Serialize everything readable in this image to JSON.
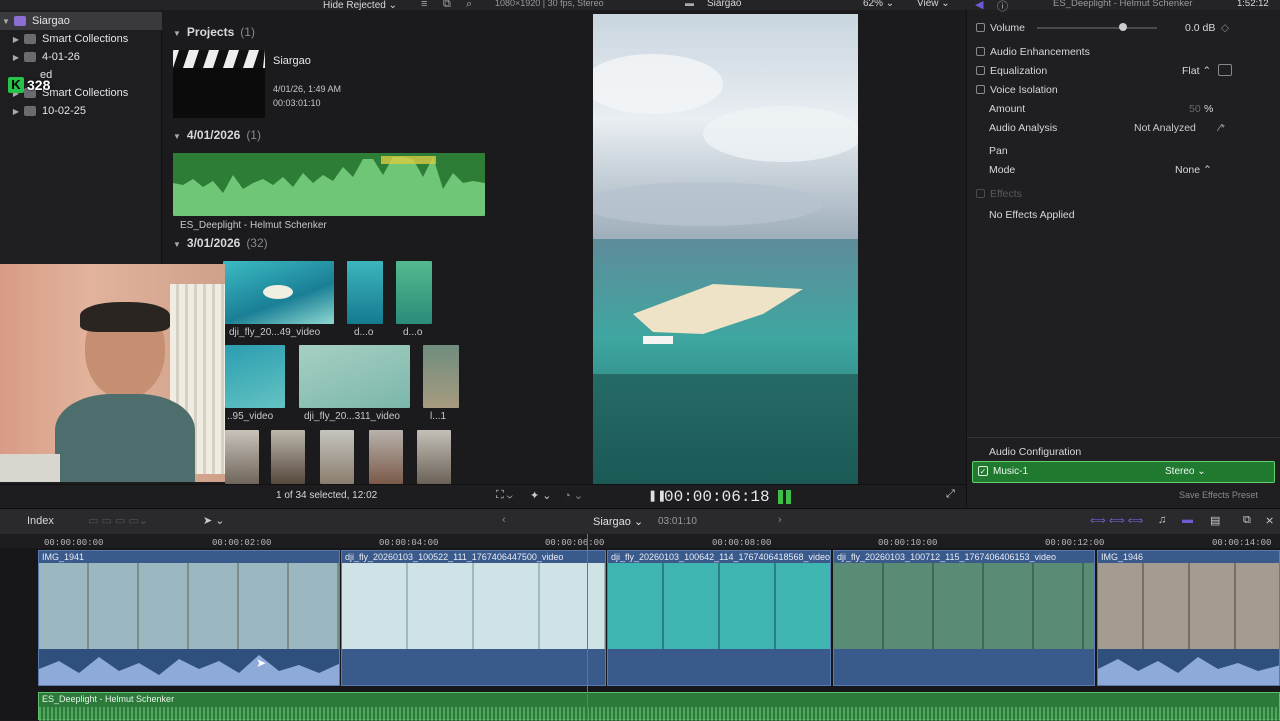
{
  "library": {
    "items": [
      {
        "label": "Siargao",
        "selected": true
      },
      {
        "label": "Smart Collections"
      },
      {
        "label": "4-01-26"
      },
      {
        "label": "ed"
      },
      {
        "label": "Smart Collections"
      },
      {
        "label": "10-02-25"
      }
    ],
    "overlay_badge": "328"
  },
  "browser": {
    "toolbar": {
      "filter_label": "Hide Rejected"
    },
    "projects_header": "Projects",
    "projects_count": "(1)",
    "project": {
      "name": "Siargao",
      "date": "4/01/26, 1:49 AM",
      "duration": "00:03:01:10"
    },
    "group1_header": "4/01/2026",
    "group1_count": "(1)",
    "audio_clip_label": "ES_Deeplight - Helmut Schenker",
    "group2_header": "3/01/2026",
    "group2_count": "(32)",
    "clip_labels": [
      "dji_fly_20...49_video",
      "d...o",
      "d...o",
      "..95_video",
      "dji_fly_20...311_video",
      "l...1"
    ],
    "selection_status": "1 of 34 selected, 12:02"
  },
  "viewer": {
    "format_info": "1080×1920 | 30 fps, Stereo",
    "title": "Siargao",
    "zoom": "62%",
    "view_label": "View",
    "timecode": "00:00:06:18"
  },
  "inspector": {
    "clip_title": "ES_Deeplight - Helmut Schenker",
    "duration": "1:52:12",
    "volume_label": "Volume",
    "volume_value": "0.0 dB",
    "enhancements_label": "Audio Enhancements",
    "equalization_label": "Equalization",
    "equalization_value": "Flat",
    "voice_isolation_label": "Voice Isolation",
    "amount_label": "Amount",
    "amount_value": "50",
    "amount_unit": "%",
    "analysis_label": "Audio Analysis",
    "analysis_value": "Not Analyzed",
    "pan_label": "Pan",
    "mode_label": "Mode",
    "mode_value": "None",
    "effects_label": "Effects",
    "no_effects_label": "No Effects Applied",
    "config_label": "Audio Configuration",
    "channel_name": "Music-1",
    "channel_value": "Stereo",
    "save_preset_label": "Save Effects Preset"
  },
  "timeline_bar": {
    "index_label": "Index",
    "project_name": "Siargao",
    "project_duration": "03:01:10"
  },
  "timeline": {
    "ruler": [
      "00:00:00:00",
      "00:00:02:00",
      "00:00:04:00",
      "00:00:06:00",
      "00:00:08:00",
      "00:00:10:00",
      "00:00:12:00",
      "00:00:14:00"
    ],
    "clips": [
      "IMG_1941",
      "dji_fly_20260103_100522_111_1767406447500_video",
      "dji_fly_20260103_100642_114_1767406418568_video",
      "dji_fly_20260103_100712_115_1767406406153_video",
      "IMG_1946"
    ],
    "music_label": "ES_Deeplight - Helmut Schenker"
  },
  "colors": {
    "accent_green": "#2c7a3a",
    "clip_blue": "#3a5a8c",
    "playhead_red": "#e0443a"
  }
}
